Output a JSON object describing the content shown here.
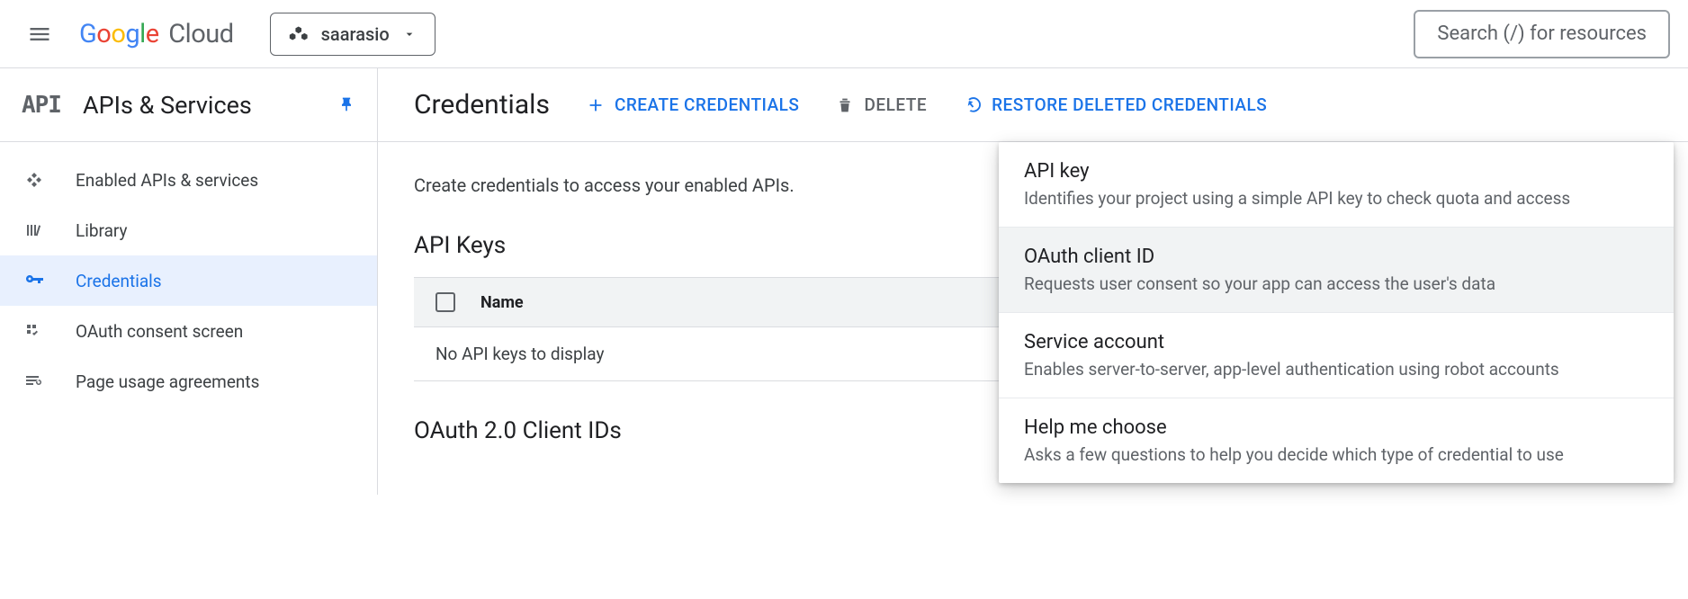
{
  "topbar": {
    "project_name": "saarasio",
    "search_placeholder": "Search (/) for resources"
  },
  "sidebar": {
    "api_label": "API",
    "title": "APIs & Services",
    "items": [
      {
        "label": "Enabled APIs & services"
      },
      {
        "label": "Library"
      },
      {
        "label": "Credentials"
      },
      {
        "label": "OAuth consent screen"
      },
      {
        "label": "Page usage agreements"
      }
    ]
  },
  "main": {
    "title": "Credentials",
    "actions": {
      "create": "CREATE CREDENTIALS",
      "delete": "DELETE",
      "restore": "RESTORE DELETED CREDENTIALS"
    },
    "hint": "Create credentials to access your enabled APIs.",
    "sections": {
      "api_keys": {
        "title": "API Keys",
        "col_name": "Name",
        "empty": "No API keys to display"
      },
      "oauth": {
        "title": "OAuth 2.0 Client IDs"
      }
    }
  },
  "dropdown": {
    "items": [
      {
        "title": "API key",
        "desc": "Identifies your project using a simple API key to check quota and access"
      },
      {
        "title": "OAuth client ID",
        "desc": "Requests user consent so your app can access the user's data"
      },
      {
        "title": "Service account",
        "desc": "Enables server-to-server, app-level authentication using robot accounts"
      },
      {
        "title": "Help me choose",
        "desc": "Asks a few questions to help you decide which type of credential to use"
      }
    ]
  }
}
